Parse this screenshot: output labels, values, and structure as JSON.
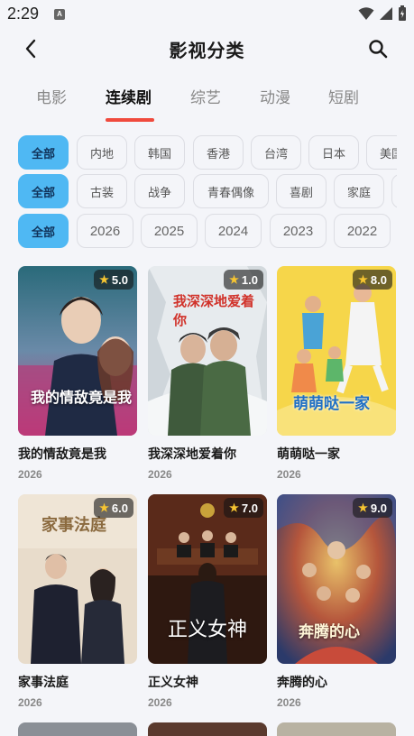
{
  "status": {
    "time": "2:29",
    "notif": "A"
  },
  "header": {
    "title": "影视分类"
  },
  "main_tabs": [
    {
      "label": "电影"
    },
    {
      "label": "连续剧"
    },
    {
      "label": "综艺"
    },
    {
      "label": "动漫"
    },
    {
      "label": "短剧"
    }
  ],
  "filters": {
    "region": [
      "全部",
      "内地",
      "韩国",
      "香港",
      "台湾",
      "日本",
      "美国"
    ],
    "genre": [
      "全部",
      "古装",
      "战争",
      "青春偶像",
      "喜剧",
      "家庭"
    ],
    "year": [
      "全部",
      "2026",
      "2025",
      "2024",
      "2023",
      "2022"
    ]
  },
  "cards": [
    {
      "title": "我的情敌竟是我",
      "year": "2026",
      "rating": "5.0",
      "poster_text": "我的情敌竟是我"
    },
    {
      "title": "我深深地爱着你",
      "year": "2026",
      "rating": "1.0",
      "poster_text": "我深深地爱着你"
    },
    {
      "title": "萌萌哒一家",
      "year": "2026",
      "rating": "8.0",
      "poster_text": "萌萌哒一家"
    },
    {
      "title": "家事法庭",
      "year": "2026",
      "rating": "6.0",
      "poster_text": "家事法庭"
    },
    {
      "title": "正义女神",
      "year": "2026",
      "rating": "7.0",
      "poster_text": "正义女神"
    },
    {
      "title": "奔腾的心",
      "year": "2026",
      "rating": "9.0",
      "poster_text": "奔腾的心"
    }
  ],
  "colors": {
    "accent": "#f04a3d",
    "chip_active": "#4fb8f3",
    "star": "#f7c531"
  }
}
